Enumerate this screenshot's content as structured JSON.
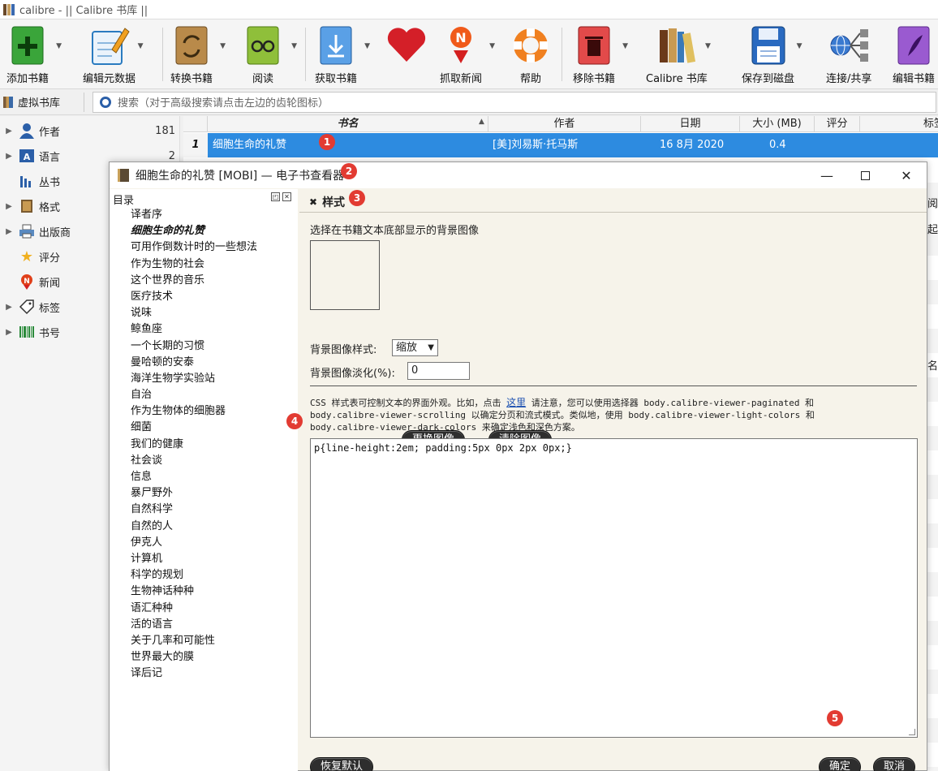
{
  "window": {
    "title": "calibre - || Calibre 书库 ||"
  },
  "toolbar": {
    "items": [
      {
        "label": "添加书籍",
        "icon": "add-book-icon"
      },
      {
        "label": "编辑元数据",
        "icon": "edit-metadata-icon"
      },
      {
        "label": "转换书籍",
        "icon": "convert-book-icon"
      },
      {
        "label": "阅读",
        "icon": "read-icon"
      },
      {
        "label": "获取书籍",
        "icon": "get-books-icon"
      },
      {
        "label": "",
        "icon": "donate-heart-icon"
      },
      {
        "label": "抓取新闻",
        "icon": "fetch-news-icon"
      },
      {
        "label": "帮助",
        "icon": "help-lifebuoy-icon"
      },
      {
        "label": "移除书籍",
        "icon": "remove-book-icon"
      },
      {
        "label": "Calibre 书库",
        "icon": "library-icon"
      },
      {
        "label": "保存到磁盘",
        "icon": "save-disk-icon"
      },
      {
        "label": "连接/共享",
        "icon": "connect-share-icon"
      },
      {
        "label": "编辑书籍",
        "icon": "edit-book-icon"
      }
    ]
  },
  "search": {
    "virtual_library": "虚拟书库",
    "placeholder": "搜索（对于高级搜索请点击左边的齿轮图标）"
  },
  "tag_browser": {
    "items": [
      {
        "label": "作者",
        "count": "181"
      },
      {
        "label": "语言",
        "count": "2"
      },
      {
        "label": "丛书",
        "count": ""
      },
      {
        "label": "格式",
        "count": ""
      },
      {
        "label": "出版商",
        "count": ""
      },
      {
        "label": "评分",
        "count": ""
      },
      {
        "label": "新闻",
        "count": ""
      },
      {
        "label": "标签",
        "count": ""
      },
      {
        "label": "书号",
        "count": ""
      }
    ]
  },
  "book_list": {
    "columns": [
      "书名",
      "作者",
      "日期",
      "大小 (MB)",
      "评分",
      "标签"
    ],
    "row": {
      "num": "1",
      "title": "细胞生命的礼赞",
      "author": "[美]刘易斯·托马斯",
      "date": "16 8月 2020",
      "size": "0.4"
    },
    "partial_right": [
      "阅",
      "起",
      "名"
    ]
  },
  "viewer": {
    "title": "细胞生命的礼赞 [MOBI] — 电子书查看器",
    "toc_title": "目录",
    "toc": [
      "译者序",
      "细胞生命的礼赞",
      "可用作倒数计时的一些想法",
      "作为生物的社会",
      "这个世界的音乐",
      "医疗技术",
      "说味",
      "鲸鱼座",
      "一个长期的习惯",
      "曼哈顿的安泰",
      "海洋生物学实验站",
      "自治",
      "作为生物体的细胞器",
      "细菌",
      "我们的健康",
      "社会谈",
      "信息",
      "暴尸野外",
      "自然科学",
      "自然的人",
      "伊克人",
      "计算机",
      "科学的规划",
      "生物神话种种",
      "语汇种种",
      "活的语言",
      "关于几率和可能性",
      "世界最大的膜",
      "译后记"
    ],
    "panel": {
      "tab": "样式",
      "bg_label": "选择在书籍文本底部显示的背景图像",
      "change_image": "更换图像",
      "clear_image": "清除图像",
      "style_label": "背景图像样式:",
      "style_value": "缩放",
      "fade_label": "背景图像淡化(%):",
      "fade_value": "0",
      "desc_1": "CSS 样式表可控制文本的界面外观。比如，点击 ",
      "desc_link": "这里",
      "desc_2": " 请注意，您可以使用选择器 body.calibre-viewer-paginated 和",
      "desc_line2": "body.calibre-viewer-scrolling 以确定分页和流式模式。类似地，使用 body.calibre-viewer-light-colors 和",
      "desc_line3": "body.calibre-viewer-dark-colors 来确定浅色和深色方案。",
      "css": "p{line-height:2em; padding:5px 0px 2px 0px;}",
      "restore": "恢复默认",
      "ok": "确定",
      "cancel": "取消"
    }
  },
  "badges": [
    "1",
    "2",
    "3",
    "4",
    "5"
  ],
  "colors": {
    "selection": "#2d8be0",
    "badge": "#e23b32",
    "viewer_bg": "#f6f3ea"
  }
}
